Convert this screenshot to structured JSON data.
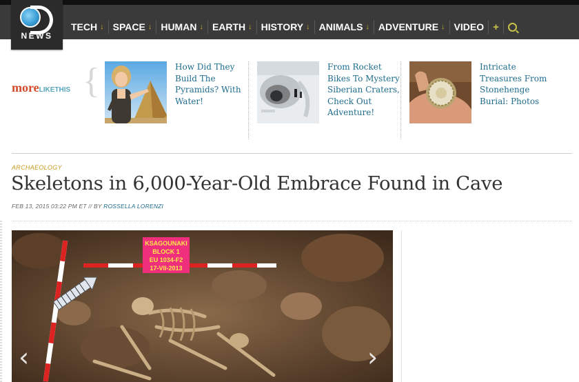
{
  "brand": {
    "logo_text": "NEWS"
  },
  "nav": {
    "items": [
      {
        "label": "TECH"
      },
      {
        "label": "SPACE"
      },
      {
        "label": "HUMAN"
      },
      {
        "label": "EARTH"
      },
      {
        "label": "HISTORY"
      },
      {
        "label": "ANIMALS"
      },
      {
        "label": "ADVENTURE"
      }
    ],
    "video_label": "VIDEO",
    "arrow_glyph": "↓",
    "plus_glyph": "+",
    "colors": {
      "bar": "#3a3a3a",
      "accent": "#c8b01c"
    }
  },
  "more_like_this": {
    "more": "more",
    "like_this": "LIKETHIS",
    "items": [
      {
        "title": "How Did They Build The Pyramids? With Water!",
        "thumb_icon": "woman-pyramids-image"
      },
      {
        "title": "From Rocket Bikes To Mystery Siberian Craters, Check Out Adventure!",
        "thumb_icon": "siberian-crater-image"
      },
      {
        "title": "Intricate Treasures From Stonehenge Burial: Photos",
        "thumb_icon": "gold-disc-hand-image"
      }
    ]
  },
  "article": {
    "category": "ARCHAEOLOGY",
    "headline": "Skeletons in 6,000-Year-Old Embrace Found in Cave",
    "byline_prefix": "FEB 13, 2015 03:22 PM ET // BY",
    "author": "ROSSELLA LORENZI",
    "photo_label": [
      "KSAGOUNAKI",
      "BLOCK 1",
      "EU 1034-F2",
      "17-VII-2013"
    ]
  }
}
